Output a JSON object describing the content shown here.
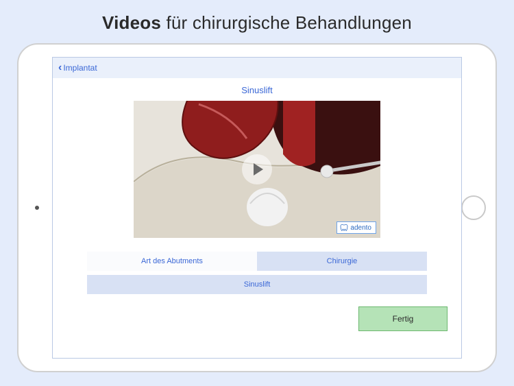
{
  "hero": {
    "bold": "Videos",
    "rest": " für chirurgische Behandlungen"
  },
  "nav": {
    "back_label": "Implantat"
  },
  "page": {
    "title": "Sinuslift"
  },
  "brand": {
    "name": "adento"
  },
  "tabs": {
    "row1": [
      {
        "label": "Art des Abutments",
        "active": false
      },
      {
        "label": "Chirurgie",
        "active": true
      }
    ],
    "row2": [
      {
        "label": "Sinuslift",
        "active": true
      }
    ]
  },
  "buttons": {
    "done": "Fertig"
  }
}
